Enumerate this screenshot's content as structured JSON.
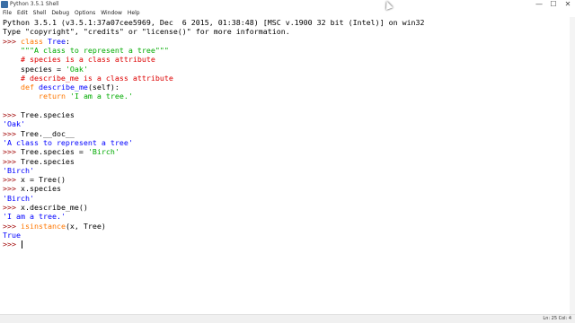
{
  "window": {
    "title": "Python 3.5.1 Shell",
    "controls": {
      "minimize": "—",
      "maximize": "☐",
      "close": "✕"
    }
  },
  "menu": [
    "File",
    "Edit",
    "Shell",
    "Debug",
    "Options",
    "Window",
    "Help"
  ],
  "shell_lines": {
    "banner1": "Python 3.5.1 (v3.5.1:37a07cee5969, Dec  6 2015, 01:38:48) [MSC v.1900 32 bit (Intel)] on win32",
    "banner2": "Type \"copyright\", \"credits\" or \"license()\" for more information.",
    "prompt": ">>> ",
    "class_kw": "class",
    "class_name": "Tree",
    "class_colon": ":",
    "docstring": "    \"\"\"A class to represent a tree\"\"\"",
    "comment1": "    # species is a class attribute",
    "species_assign": "    species = ",
    "species_value": "'Oak'",
    "comment2": "    # describe_me is a class attribute",
    "def_indent": "    ",
    "def_kw": "def",
    "def_name": "describe_me",
    "def_params": "(self):",
    "return_indent": "        ",
    "return_kw": "return",
    "return_value": "'I am a tree.'",
    "cmd1": "Tree.species",
    "out1": "'Oak'",
    "cmd2": "Tree.__doc__",
    "out2": "'A class to represent a tree'",
    "cmd3a": "Tree.species = ",
    "cmd3b": "'Birch'",
    "cmd4": "Tree.species",
    "out4": "'Birch'",
    "cmd5": "x = Tree()",
    "cmd6": "x.species",
    "out6": "'Birch'",
    "cmd7": "x.describe_me()",
    "out7": "'I am a tree.'",
    "cmd8_fn": "isinstance",
    "cmd8_args": "(x, Tree)",
    "out8": "True"
  },
  "status": {
    "position": "Ln: 25  Col: 4"
  },
  "colors": {
    "keyword": "#ff7700",
    "string": "#00aa00",
    "comment": "#dd0000",
    "definition": "#0000ff",
    "prompt": "#a00000",
    "output": "#0000ff"
  }
}
